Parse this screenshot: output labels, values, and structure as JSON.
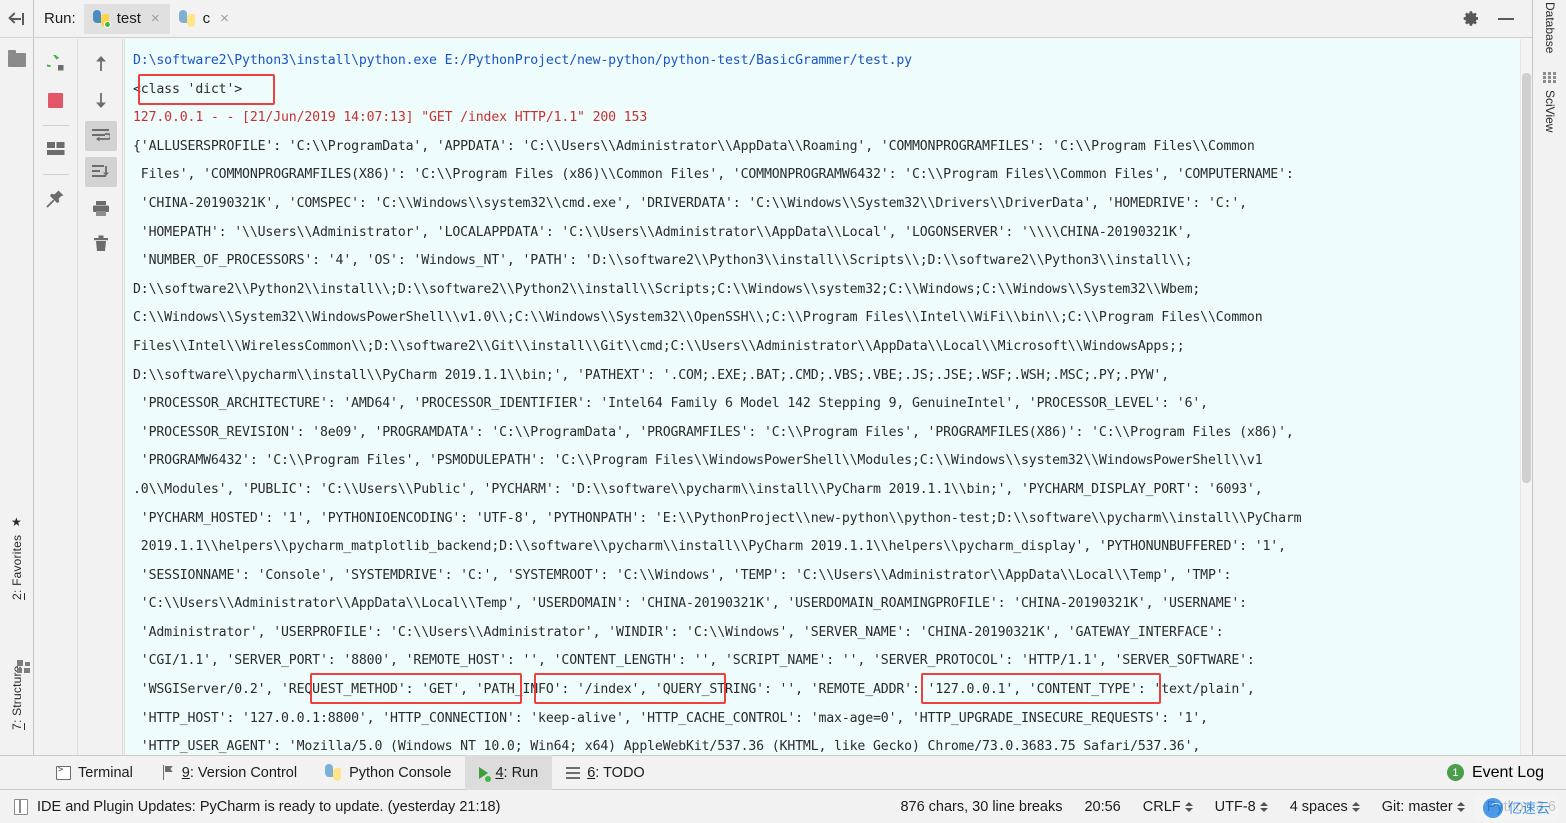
{
  "window": {
    "left_stripe": {
      "hide_icon": "hide-sidebar-icon",
      "folder_icon": "project-folder-icon",
      "tabs": [
        {
          "num": "2",
          "label": ": Favorites",
          "icon": "star-icon"
        },
        {
          "num": "7",
          "label": ": Structure",
          "icon": "structure-grid-icon"
        }
      ]
    },
    "right_stripe": {
      "tabs": [
        {
          "label": "Database",
          "icon": "database-icon"
        },
        {
          "label": "SciView",
          "icon": "sciview-grid-icon"
        }
      ]
    }
  },
  "run_panel": {
    "label": "Run:",
    "tabs": [
      {
        "name": "test",
        "icon": "python-running-icon",
        "active": true,
        "close": "×"
      },
      {
        "name": "c",
        "icon": "python-icon",
        "active": false,
        "close": "×"
      }
    ],
    "header_actions": [
      {
        "name": "settings-gear",
        "label": "⚙"
      },
      {
        "name": "minimize",
        "label": "—"
      }
    ],
    "toolbar_left": [
      {
        "name": "rerun-button",
        "icon": "rerun-green-arrow-icon"
      },
      {
        "name": "stop-button",
        "icon": "stop-red-square-icon"
      },
      {
        "name": "layout-button",
        "icon": "layout-icon"
      },
      {
        "name": "pin-tab-button",
        "icon": "pin-icon"
      }
    ],
    "toolbar_right": [
      {
        "name": "up-stack-button",
        "icon": "arrow-up-icon"
      },
      {
        "name": "down-stack-button",
        "icon": "arrow-down-icon"
      },
      {
        "name": "soft-wrap-button",
        "icon": "soft-wrap-icon",
        "selected": true
      },
      {
        "name": "scroll-to-end-button",
        "icon": "scroll-to-end-icon",
        "selected": true
      },
      {
        "name": "print-button",
        "icon": "printer-icon"
      },
      {
        "name": "clear-all-button",
        "icon": "trash-icon"
      }
    ],
    "console": {
      "command_line": "D:\\software2\\Python3\\install\\python.exe E:/PythonProject/new-python/python-test/BasicGrammer/test.py",
      "class_line": "<class 'dict'>",
      "request_log": "127.0.0.1 - - [21/Jun/2019 14:07:13] \"GET /index HTTP/1.1\" 200 153",
      "env_dict_lines": [
        "{'ALLUSERSPROFILE': 'C:\\\\ProgramData', 'APPDATA': 'C:\\\\Users\\\\Administrator\\\\AppData\\\\Roaming', 'COMMONPROGRAMFILES': 'C:\\\\Program Files\\\\Common",
        " Files', 'COMMONPROGRAMFILES(X86)': 'C:\\\\Program Files (x86)\\\\Common Files', 'COMMONPROGRAMW6432': 'C:\\\\Program Files\\\\Common Files', 'COMPUTERNAME':",
        " 'CHINA-20190321K', 'COMSPEC': 'C:\\\\Windows\\\\system32\\\\cmd.exe', 'DRIVERDATA': 'C:\\\\Windows\\\\System32\\\\Drivers\\\\DriverData', 'HOMEDRIVE': 'C:',",
        " 'HOMEPATH': '\\\\Users\\\\Administrator', 'LOCALAPPDATA': 'C:\\\\Users\\\\Administrator\\\\AppData\\\\Local', 'LOGONSERVER': '\\\\\\\\CHINA-20190321K',",
        " 'NUMBER_OF_PROCESSORS': '4', 'OS': 'Windows_NT', 'PATH': 'D:\\\\software2\\\\Python3\\\\install\\\\Scripts\\\\;D:\\\\software2\\\\Python3\\\\install\\\\;",
        "D:\\\\software2\\\\Python2\\\\install\\\\;D:\\\\software2\\\\Python2\\\\install\\\\Scripts;C:\\\\Windows\\\\system32;C:\\\\Windows;C:\\\\Windows\\\\System32\\\\Wbem;",
        "C:\\\\Windows\\\\System32\\\\WindowsPowerShell\\\\v1.0\\\\;C:\\\\Windows\\\\System32\\\\OpenSSH\\\\;C:\\\\Program Files\\\\Intel\\\\WiFi\\\\bin\\\\;C:\\\\Program Files\\\\Common",
        "Files\\\\Intel\\\\WirelessCommon\\\\;D:\\\\software2\\\\Git\\\\install\\\\Git\\\\cmd;C:\\\\Users\\\\Administrator\\\\AppData\\\\Local\\\\Microsoft\\\\WindowsApps;;",
        "D:\\\\software\\\\pycharm\\\\install\\\\PyCharm 2019.1.1\\\\bin;', 'PATHEXT': '.COM;.EXE;.BAT;.CMD;.VBS;.VBE;.JS;.JSE;.WSF;.WSH;.MSC;.PY;.PYW',",
        " 'PROCESSOR_ARCHITECTURE': 'AMD64', 'PROCESSOR_IDENTIFIER': 'Intel64 Family 6 Model 142 Stepping 9, GenuineIntel', 'PROCESSOR_LEVEL': '6',",
        " 'PROCESSOR_REVISION': '8e09', 'PROGRAMDATA': 'C:\\\\ProgramData', 'PROGRAMFILES': 'C:\\\\Program Files', 'PROGRAMFILES(X86)': 'C:\\\\Program Files (x86)',",
        " 'PROGRAMW6432': 'C:\\\\Program Files', 'PSMODULEPATH': 'C:\\\\Program Files\\\\WindowsPowerShell\\\\Modules;C:\\\\Windows\\\\system32\\\\WindowsPowerShell\\\\v1",
        ".0\\\\Modules', 'PUBLIC': 'C:\\\\Users\\\\Public', 'PYCHARM': 'D:\\\\software\\\\pycharm\\\\install\\\\PyCharm 2019.1.1\\\\bin;', 'PYCHARM_DISPLAY_PORT': '6093',",
        " 'PYCHARM_HOSTED': '1', 'PYTHONIOENCODING': 'UTF-8', 'PYTHONPATH': 'E:\\\\PythonProject\\\\new-python\\\\python-test;D:\\\\software\\\\pycharm\\\\install\\\\PyCharm",
        " 2019.1.1\\\\helpers\\\\pycharm_matplotlib_backend;D:\\\\software\\\\pycharm\\\\install\\\\PyCharm 2019.1.1\\\\helpers\\\\pycharm_display', 'PYTHONUNBUFFERED': '1',",
        " 'SESSIONNAME': 'Console', 'SYSTEMDRIVE': 'C:', 'SYSTEMROOT': 'C:\\\\Windows', 'TEMP': 'C:\\\\Users\\\\Administrator\\\\AppData\\\\Local\\\\Temp', 'TMP':",
        " 'C:\\\\Users\\\\Administrator\\\\AppData\\\\Local\\\\Temp', 'USERDOMAIN': 'CHINA-20190321K', 'USERDOMAIN_ROAMINGPROFILE': 'CHINA-20190321K', 'USERNAME':",
        " 'Administrator', 'USERPROFILE': 'C:\\\\Users\\\\Administrator', 'WINDIR': 'C:\\\\Windows', 'SERVER_NAME': 'CHINA-20190321K', 'GATEWAY_INTERFACE':",
        " 'CGI/1.1', 'SERVER_PORT': '8800', 'REMOTE_HOST': '', 'CONTENT_LENGTH': '', 'SCRIPT_NAME': '', 'SERVER_PROTOCOL': 'HTTP/1.1', 'SERVER_SOFTWARE':",
        " 'WSGIServer/0.2', 'REQUEST_METHOD': 'GET', 'PATH_INFO': '/index', 'QUERY_STRING': '', 'REMOTE_ADDR': '127.0.0.1', 'CONTENT_TYPE': 'text/plain',",
        " 'HTTP_HOST': '127.0.0.1:8800', 'HTTP_CONNECTION': 'keep-alive', 'HTTP_CACHE_CONTROL': 'max-age=0', 'HTTP_UPGRADE_INSECURE_REQUESTS': '1',",
        " 'HTTP_USER_AGENT': 'Mozilla/5.0 (Windows NT 10.0; Win64; x64) AppleWebKit/537.36 (KHTML, like Gecko) Chrome/73.0.3683.75 Safari/537.36',"
      ],
      "annotations": [
        {
          "name": "class-dict-highlight",
          "color": "#ef3f3f"
        },
        {
          "name": "request-method-highlight",
          "color": "#ef3f3f"
        },
        {
          "name": "path-info-highlight",
          "color": "#ef3f3f"
        },
        {
          "name": "remote-addr-highlight",
          "color": "#ef3f3f"
        }
      ]
    }
  },
  "tool_window_bar": {
    "items": [
      {
        "label": "Terminal",
        "num": "",
        "icon": "terminal-icon",
        "active": false
      },
      {
        "label": ": Version Control",
        "num": "9",
        "icon": "version-control-icon",
        "active": false
      },
      {
        "label": "Python Console",
        "num": "",
        "icon": "python-icon",
        "active": false
      },
      {
        "label": ": Run",
        "num": "4",
        "icon": "run-play-icon",
        "active": true
      },
      {
        "label": ": TODO",
        "num": "6",
        "icon": "todo-list-icon",
        "active": false
      }
    ],
    "event_log": {
      "label": "Event Log",
      "count": "1"
    }
  },
  "status_bar": {
    "message": "IDE and Plugin Updates: PyCharm is ready to update. (yesterday 21:18)",
    "chars": "876 chars, 30 line breaks",
    "caret": "20:56",
    "line_separator": "CRLF",
    "encoding": "UTF-8",
    "indent": "4 spaces",
    "branch": "Git: master",
    "interpreter": "Python 3.6"
  },
  "watermark": {
    "logo": "͡͡",
    "text": "亿速云"
  }
}
